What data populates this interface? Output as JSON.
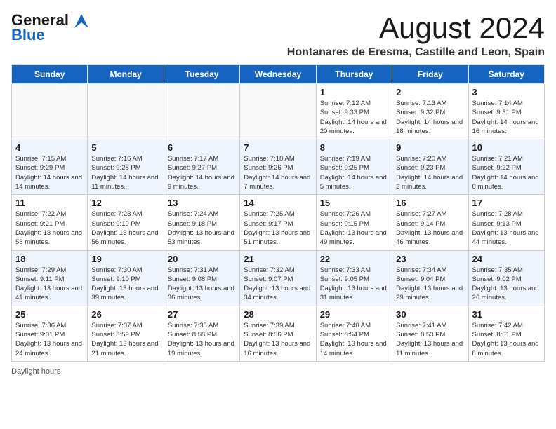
{
  "header": {
    "logo_line1": "General",
    "logo_line2": "Blue",
    "main_title": "August 2024",
    "subtitle": "Hontanares de Eresma, Castille and Leon, Spain"
  },
  "calendar": {
    "days_of_week": [
      "Sunday",
      "Monday",
      "Tuesday",
      "Wednesday",
      "Thursday",
      "Friday",
      "Saturday"
    ],
    "weeks": [
      [
        {
          "day": "",
          "info": ""
        },
        {
          "day": "",
          "info": ""
        },
        {
          "day": "",
          "info": ""
        },
        {
          "day": "",
          "info": ""
        },
        {
          "day": "1",
          "info": "Sunrise: 7:12 AM\nSunset: 9:33 PM\nDaylight: 14 hours and 20 minutes."
        },
        {
          "day": "2",
          "info": "Sunrise: 7:13 AM\nSunset: 9:32 PM\nDaylight: 14 hours and 18 minutes."
        },
        {
          "day": "3",
          "info": "Sunrise: 7:14 AM\nSunset: 9:31 PM\nDaylight: 14 hours and 16 minutes."
        }
      ],
      [
        {
          "day": "4",
          "info": "Sunrise: 7:15 AM\nSunset: 9:29 PM\nDaylight: 14 hours and 14 minutes."
        },
        {
          "day": "5",
          "info": "Sunrise: 7:16 AM\nSunset: 9:28 PM\nDaylight: 14 hours and 11 minutes."
        },
        {
          "day": "6",
          "info": "Sunrise: 7:17 AM\nSunset: 9:27 PM\nDaylight: 14 hours and 9 minutes."
        },
        {
          "day": "7",
          "info": "Sunrise: 7:18 AM\nSunset: 9:26 PM\nDaylight: 14 hours and 7 minutes."
        },
        {
          "day": "8",
          "info": "Sunrise: 7:19 AM\nSunset: 9:25 PM\nDaylight: 14 hours and 5 minutes."
        },
        {
          "day": "9",
          "info": "Sunrise: 7:20 AM\nSunset: 9:23 PM\nDaylight: 14 hours and 3 minutes."
        },
        {
          "day": "10",
          "info": "Sunrise: 7:21 AM\nSunset: 9:22 PM\nDaylight: 14 hours and 0 minutes."
        }
      ],
      [
        {
          "day": "11",
          "info": "Sunrise: 7:22 AM\nSunset: 9:21 PM\nDaylight: 13 hours and 58 minutes."
        },
        {
          "day": "12",
          "info": "Sunrise: 7:23 AM\nSunset: 9:19 PM\nDaylight: 13 hours and 56 minutes."
        },
        {
          "day": "13",
          "info": "Sunrise: 7:24 AM\nSunset: 9:18 PM\nDaylight: 13 hours and 53 minutes."
        },
        {
          "day": "14",
          "info": "Sunrise: 7:25 AM\nSunset: 9:17 PM\nDaylight: 13 hours and 51 minutes."
        },
        {
          "day": "15",
          "info": "Sunrise: 7:26 AM\nSunset: 9:15 PM\nDaylight: 13 hours and 49 minutes."
        },
        {
          "day": "16",
          "info": "Sunrise: 7:27 AM\nSunset: 9:14 PM\nDaylight: 13 hours and 46 minutes."
        },
        {
          "day": "17",
          "info": "Sunrise: 7:28 AM\nSunset: 9:13 PM\nDaylight: 13 hours and 44 minutes."
        }
      ],
      [
        {
          "day": "18",
          "info": "Sunrise: 7:29 AM\nSunset: 9:11 PM\nDaylight: 13 hours and 41 minutes."
        },
        {
          "day": "19",
          "info": "Sunrise: 7:30 AM\nSunset: 9:10 PM\nDaylight: 13 hours and 39 minutes."
        },
        {
          "day": "20",
          "info": "Sunrise: 7:31 AM\nSunset: 9:08 PM\nDaylight: 13 hours and 36 minutes."
        },
        {
          "day": "21",
          "info": "Sunrise: 7:32 AM\nSunset: 9:07 PM\nDaylight: 13 hours and 34 minutes."
        },
        {
          "day": "22",
          "info": "Sunrise: 7:33 AM\nSunset: 9:05 PM\nDaylight: 13 hours and 31 minutes."
        },
        {
          "day": "23",
          "info": "Sunrise: 7:34 AM\nSunset: 9:04 PM\nDaylight: 13 hours and 29 minutes."
        },
        {
          "day": "24",
          "info": "Sunrise: 7:35 AM\nSunset: 9:02 PM\nDaylight: 13 hours and 26 minutes."
        }
      ],
      [
        {
          "day": "25",
          "info": "Sunrise: 7:36 AM\nSunset: 9:01 PM\nDaylight: 13 hours and 24 minutes."
        },
        {
          "day": "26",
          "info": "Sunrise: 7:37 AM\nSunset: 8:59 PM\nDaylight: 13 hours and 21 minutes."
        },
        {
          "day": "27",
          "info": "Sunrise: 7:38 AM\nSunset: 8:58 PM\nDaylight: 13 hours and 19 minutes."
        },
        {
          "day": "28",
          "info": "Sunrise: 7:39 AM\nSunset: 8:56 PM\nDaylight: 13 hours and 16 minutes."
        },
        {
          "day": "29",
          "info": "Sunrise: 7:40 AM\nSunset: 8:54 PM\nDaylight: 13 hours and 14 minutes."
        },
        {
          "day": "30",
          "info": "Sunrise: 7:41 AM\nSunset: 8:53 PM\nDaylight: 13 hours and 11 minutes."
        },
        {
          "day": "31",
          "info": "Sunrise: 7:42 AM\nSunset: 8:51 PM\nDaylight: 13 hours and 8 minutes."
        }
      ]
    ]
  },
  "footer": {
    "daylight_label": "Daylight hours"
  }
}
